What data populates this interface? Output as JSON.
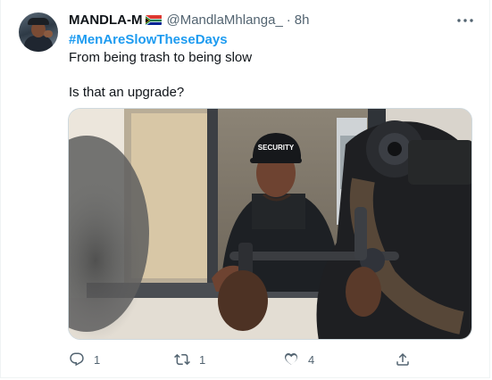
{
  "tweet": {
    "author": {
      "display_name": "MANDLA-M",
      "flag_icon": "south-africa-flag-icon",
      "handle": "@MandlaMhlanga_",
      "separator": "·",
      "time": "8h"
    },
    "hashtag": "#MenAreSlowTheseDays",
    "text_line_1": "From being trash to being slow",
    "text_line_2": "Is that an upgrade?",
    "image": {
      "cap_text": "SECURITY"
    },
    "actions": {
      "reply_icon": "reply-icon",
      "reply_count": "1",
      "retweet_icon": "retweet-icon",
      "retweet_count": "1",
      "like_icon": "heart-icon",
      "like_count": "4",
      "share_icon": "share-icon"
    }
  },
  "colors": {
    "link": "#1d9bf0",
    "secondary_text": "#536471",
    "primary_text": "#0f1419"
  }
}
